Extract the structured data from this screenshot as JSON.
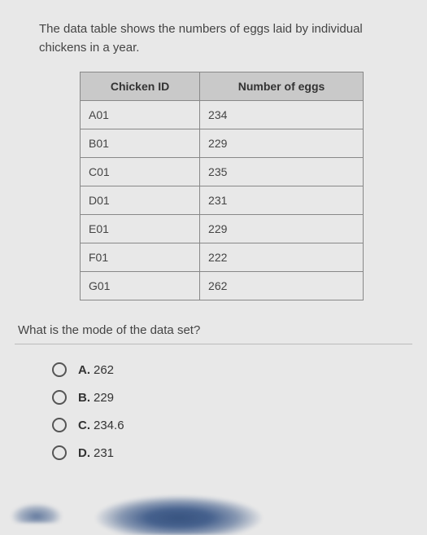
{
  "intro": "The data table shows the numbers of eggs laid by individual chickens in a year.",
  "table": {
    "headers": {
      "col1": "Chicken ID",
      "col2": "Number of eggs"
    },
    "rows": [
      {
        "id": "A01",
        "eggs": "234"
      },
      {
        "id": "B01",
        "eggs": "229"
      },
      {
        "id": "C01",
        "eggs": "235"
      },
      {
        "id": "D01",
        "eggs": "231"
      },
      {
        "id": "E01",
        "eggs": "229"
      },
      {
        "id": "F01",
        "eggs": "222"
      },
      {
        "id": "G01",
        "eggs": "262"
      }
    ]
  },
  "question": "What is the mode of the data set?",
  "options": [
    {
      "letter": "A.",
      "text": "262"
    },
    {
      "letter": "B.",
      "text": "229"
    },
    {
      "letter": "C.",
      "text": "234.6"
    },
    {
      "letter": "D.",
      "text": "231"
    }
  ],
  "chart_data": {
    "type": "table",
    "title": "Numbers of eggs laid by individual chickens in a year",
    "columns": [
      "Chicken ID",
      "Number of eggs"
    ],
    "rows": [
      [
        "A01",
        234
      ],
      [
        "B01",
        229
      ],
      [
        "C01",
        235
      ],
      [
        "D01",
        231
      ],
      [
        "E01",
        229
      ],
      [
        "F01",
        222
      ],
      [
        "G01",
        262
      ]
    ]
  }
}
